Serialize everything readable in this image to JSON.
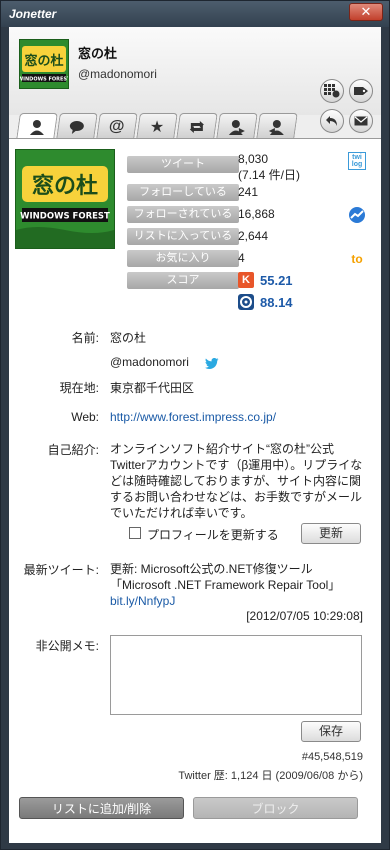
{
  "window": {
    "title": "Jonetter",
    "close_label": "✕"
  },
  "header": {
    "name": "窓の杜",
    "handle": "@madonomori"
  },
  "avatar": {
    "logo_text": "窓の杜",
    "logo_sub": "WINDOWS FOREST"
  },
  "tabs": [
    {
      "icon": "user-icon"
    },
    {
      "icon": "speech-bubble-icon"
    },
    {
      "icon": "at-sign-icon"
    },
    {
      "icon": "star-icon"
    },
    {
      "icon": "retweet-icon"
    },
    {
      "icon": "following-icon"
    },
    {
      "icon": "followers-icon"
    }
  ],
  "stats": [
    {
      "label": "ツイート",
      "value": "8,030",
      "extra": "(7.14 件/日)"
    },
    {
      "label": "フォローしている",
      "value": "241"
    },
    {
      "label": "フォローされている",
      "value": "16,868"
    },
    {
      "label": "リストに入っている",
      "value": "2,644"
    },
    {
      "label": "お気に入り",
      "value": "4"
    },
    {
      "label": "スコア",
      "value": ""
    }
  ],
  "scores": {
    "klout": "55.21",
    "other": "88.14"
  },
  "side_icons": {
    "twilog_text": "twi log",
    "favstar_text": "to"
  },
  "profile": {
    "name_label": "名前:",
    "name_value": "窓の杜",
    "handle_value": "@madonomori",
    "location_label": "現在地:",
    "location_value": "東京都千代田区",
    "web_label": "Web:",
    "web_value": "http://www.forest.impress.co.jp/",
    "bio_label": "自己紹介:",
    "bio_value": "オンラインソフト紹介サイト“窓の杜”公式Twitterアカウントです（β運用中）。リプライなどは随時確認しておりますが、サイト内容に関するお問い合わせなどは、お手数ですがメールでいただければ幸いです。"
  },
  "update_profile": {
    "checkbox_label": "プロフィールを更新する",
    "button_label": "更新",
    "checked": false
  },
  "latest": {
    "label": "最新ツイート:",
    "text": "更新: Microsoft公式の.NET修復ツール「Microsoft .NET Framework Repair Tool」",
    "link": "bit.ly/NnfypJ",
    "date": "[2012/07/05 10:29:08]"
  },
  "memo": {
    "label": "非公開メモ:",
    "value": "",
    "save_label": "保存"
  },
  "footer_info": {
    "user_number": "#45,548,519",
    "twitter_since": "Twitter 歴: 1,124 日 (2009/06/08 から)"
  },
  "bottom_buttons": {
    "list_label": "リストに追加/削除",
    "block_label": "ブロック"
  },
  "colors": {
    "accent": "#2e8b2e",
    "link": "#1a5aa6",
    "titlebar": "#33414f"
  }
}
